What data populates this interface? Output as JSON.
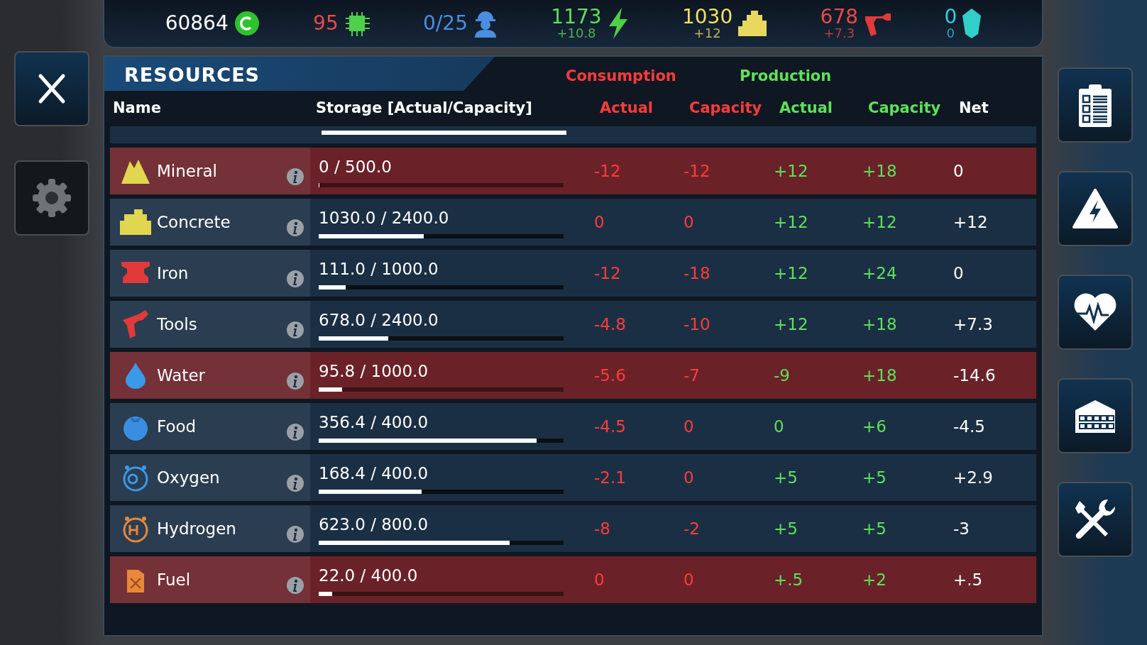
{
  "top_bar": [
    {
      "value": "60864",
      "color": "#ffffff"
    },
    {
      "value": "95",
      "color": "#e84a4a"
    },
    {
      "value": "0/25",
      "color": "#4a8ee0"
    },
    {
      "value": "1173",
      "delta": "+10.8",
      "color": "#5ee05a"
    },
    {
      "value": "1030",
      "delta": "+12",
      "color": "#f0e060"
    },
    {
      "value": "678",
      "delta": "+7.3",
      "color": "#e84a4a"
    },
    {
      "value": "0",
      "delta": "0",
      "color": "#30d0e0"
    }
  ],
  "panel": {
    "title": "RESOURCES",
    "groups": [
      {
        "label": "Consumption",
        "color": "#ff3b3b"
      },
      {
        "label": "Production",
        "color": "#5ee05a"
      }
    ],
    "columns": [
      {
        "label": "Name",
        "color": "#ffffff"
      },
      {
        "label": "Storage [Actual/Capacity]",
        "color": "#ffffff"
      },
      {
        "label": "Actual",
        "color": "#ff3b3b"
      },
      {
        "label": "Capacity",
        "color": "#ff3b3b"
      },
      {
        "label": "Actual",
        "color": "#5ee05a"
      },
      {
        "label": "Capacity",
        "color": "#5ee05a"
      },
      {
        "label": "Net",
        "color": "#ffffff"
      }
    ],
    "partial_row": {
      "level": 1.0
    },
    "rows": [
      {
        "name": "Mineral",
        "storage": "0 / 500.0",
        "level": 0,
        "warning": true,
        "cons_actual": "-12",
        "cons_capacity": "-12",
        "prod_actual": "+12",
        "prod_capacity": "+18",
        "net": "0"
      },
      {
        "name": "Concrete",
        "storage": "1030.0 / 2400.0",
        "level": 0.43,
        "warning": false,
        "cons_actual": "0",
        "cons_capacity": "0",
        "prod_actual": "+12",
        "prod_capacity": "+12",
        "net": "+12"
      },
      {
        "name": "Iron",
        "storage": "111.0 / 1000.0",
        "level": 0.111,
        "warning": false,
        "cons_actual": "-12",
        "cons_capacity": "-18",
        "prod_actual": "+12",
        "prod_capacity": "+24",
        "net": "0"
      },
      {
        "name": "Tools",
        "storage": "678.0 / 2400.0",
        "level": 0.283,
        "warning": false,
        "cons_actual": "-4.8",
        "cons_capacity": "-10",
        "prod_actual": "+12",
        "prod_capacity": "+18",
        "net": "+7.3"
      },
      {
        "name": "Water",
        "storage": "95.8 / 1000.0",
        "level": 0.096,
        "warning": true,
        "cons_actual": "-5.6",
        "cons_capacity": "-7",
        "prod_actual": "-9",
        "prod_capacity": "+18",
        "net": "-14.6"
      },
      {
        "name": "Food",
        "storage": "356.4 / 400.0",
        "level": 0.891,
        "warning": false,
        "cons_actual": "-4.5",
        "cons_capacity": "0",
        "prod_actual": "0",
        "prod_capacity": "+6",
        "net": "-4.5"
      },
      {
        "name": "Oxygen",
        "storage": "168.4 / 400.0",
        "level": 0.421,
        "warning": false,
        "cons_actual": "-2.1",
        "cons_capacity": "0",
        "prod_actual": "+5",
        "prod_capacity": "+5",
        "net": "+2.9"
      },
      {
        "name": "Hydrogen",
        "storage": "623.0 / 800.0",
        "level": 0.779,
        "warning": false,
        "cons_actual": "-8",
        "cons_capacity": "-2",
        "prod_actual": "+5",
        "prod_capacity": "+5",
        "net": "-3"
      },
      {
        "name": "Fuel",
        "storage": "22.0 / 400.0",
        "level": 0.055,
        "warning": true,
        "cons_actual": "0",
        "cons_capacity": "0",
        "prod_actual": "+.5",
        "prod_capacity": "+2",
        "net": "+.5"
      }
    ]
  }
}
